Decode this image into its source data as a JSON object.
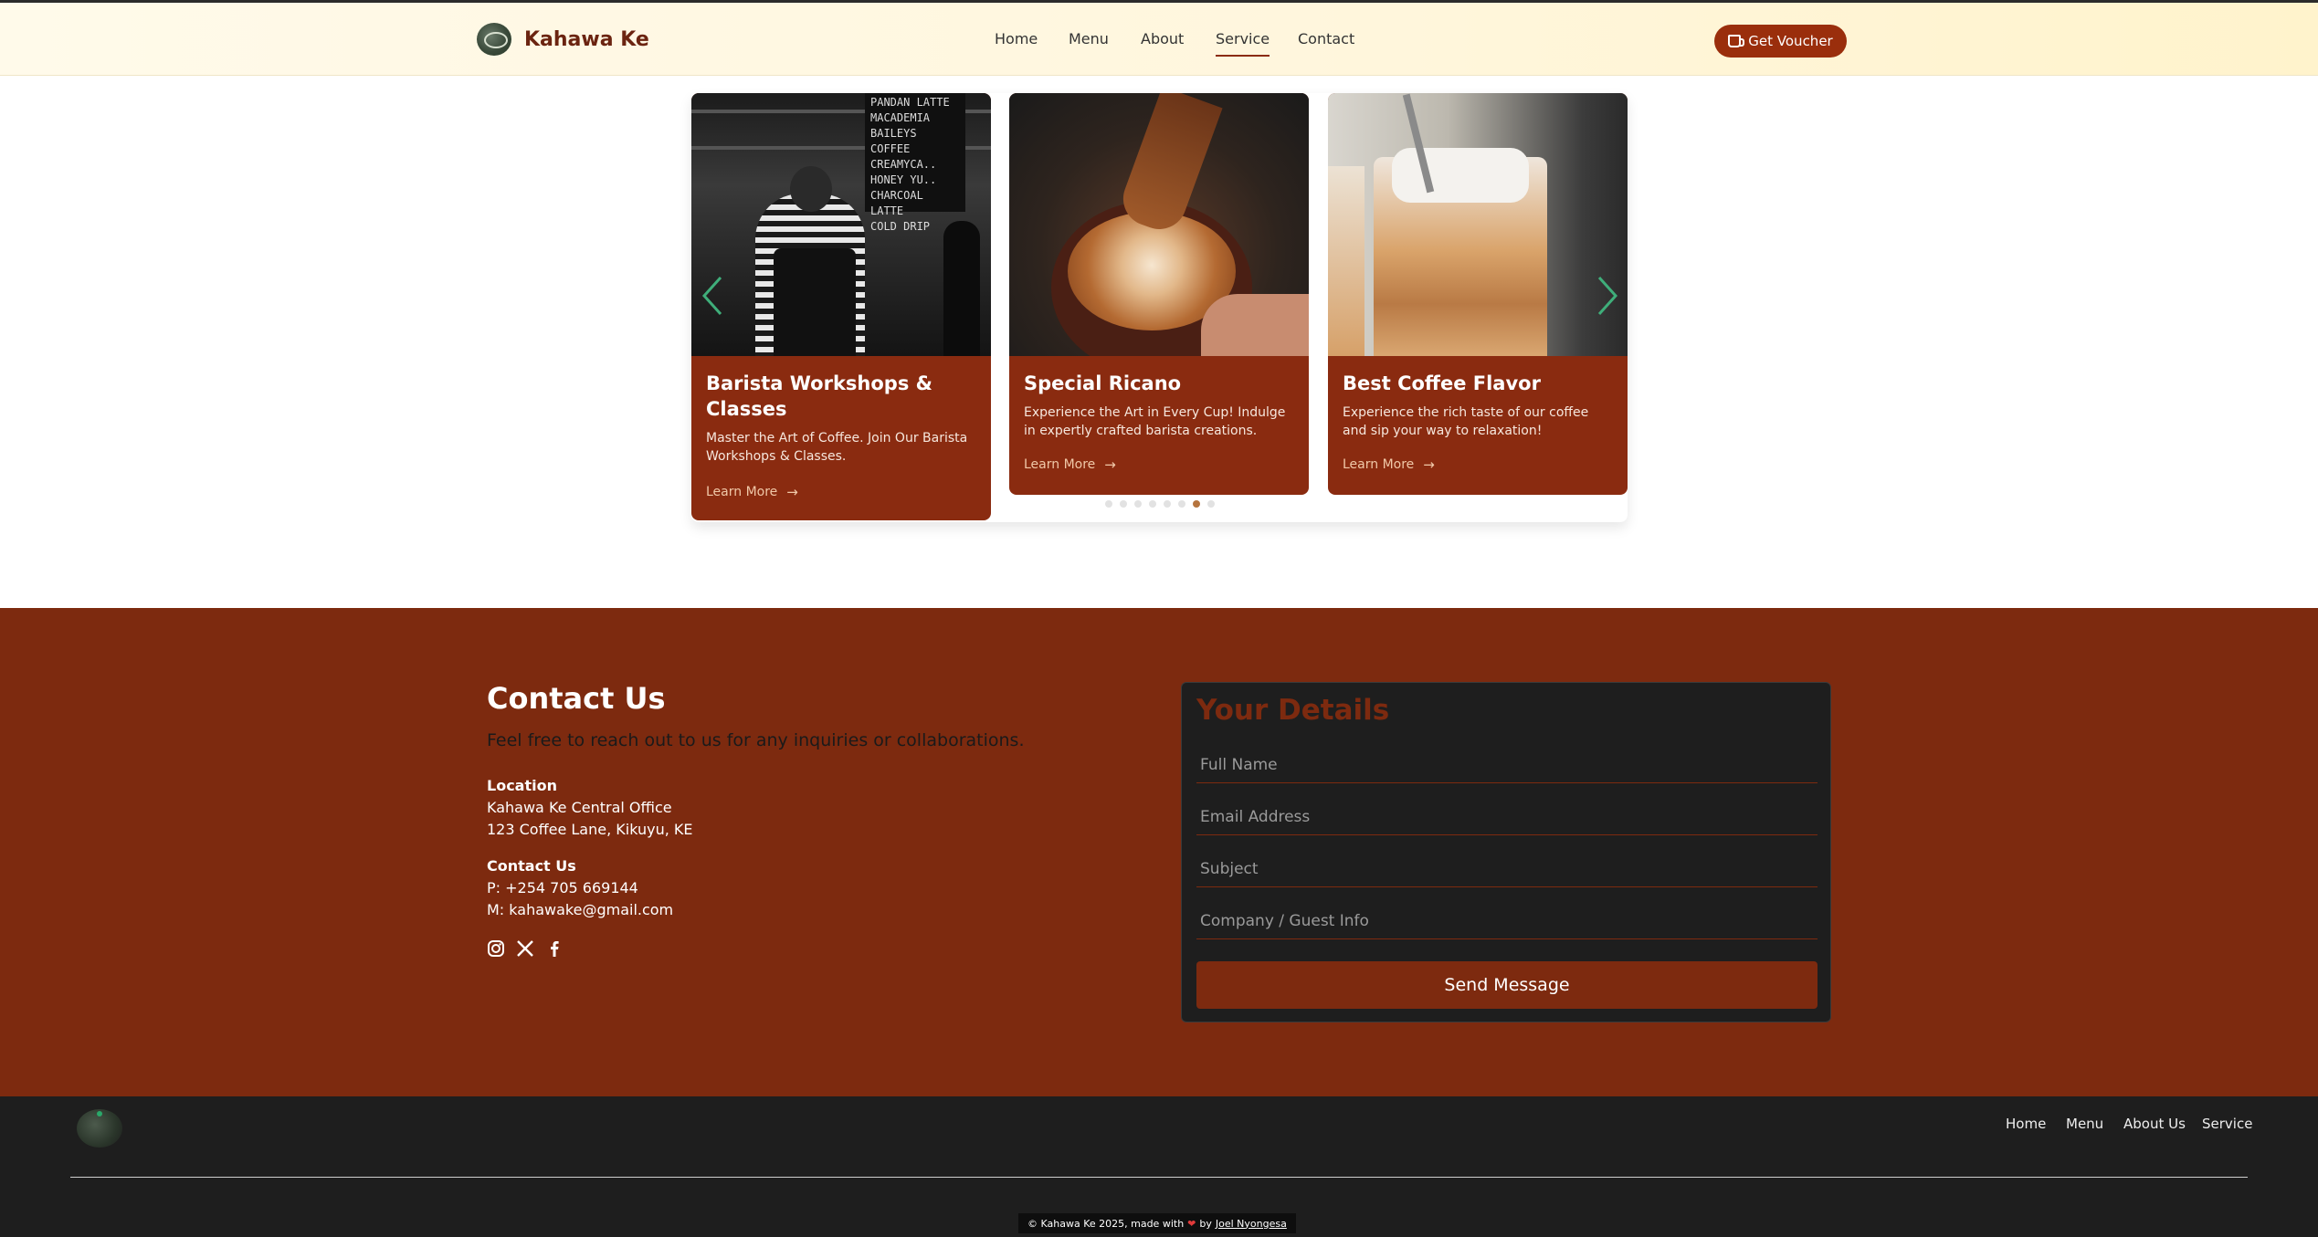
{
  "header": {
    "brand": "Kahawa Ke",
    "nav": [
      "Home",
      "Menu",
      "About",
      "Service",
      "Contact"
    ],
    "active_nav": "Service",
    "voucher_label": "Get Voucher",
    "voucher_icon": "coffee-cup-icon"
  },
  "carousel": {
    "cards": [
      {
        "title": "Barista Workshops & Classes",
        "description": "Master the Art of Coffee. Join Our Barista Workshops & Classes.",
        "link": "Learn More",
        "menu_board": [
          "PANDAN LATTE",
          "MACADEMIA",
          "BAILEYS COFFEE",
          "CREAMYCA..",
          "HONEY YU..",
          "CHARCOAL LATTE",
          "COLD DRIP"
        ]
      },
      {
        "title": "Special Ricano",
        "description": "Experience the Art in Every Cup! Indulge in expertly crafted barista creations.",
        "link": "Learn More"
      },
      {
        "title": "Best Coffee Flavor",
        "description": "Experience the rich taste of our coffee and sip your way to relaxation!",
        "link": "Learn More"
      }
    ],
    "dots_total": 8,
    "active_dot": 7,
    "accent": "#8a2b10"
  },
  "contact": {
    "title": "Contact Us",
    "subtitle": "Feel free to reach out to us for any inquiries or collaborations.",
    "location_label": "Location",
    "location_line1": "Kahawa Ke Central Office",
    "location_line2": "123 Coffee Lane, Kikuyu, KE",
    "contact_label": "Contact Us",
    "phone": "P: +254 705 669144",
    "email": "M: kahawake@gmail.com",
    "socials": [
      "instagram-icon",
      "x-icon",
      "facebook-icon"
    ],
    "form": {
      "title": "Your Details",
      "full_name_placeholder": "Full Name",
      "email_placeholder": "Email Address",
      "subject_placeholder": "Subject",
      "company_placeholder": "Company / Guest Info",
      "send_label": "Send Message"
    },
    "bg_color": "#7d2a0f"
  },
  "footer": {
    "nav": [
      "Home",
      "Menu",
      "About Us",
      "Service"
    ],
    "copyright_prefix": "© Kahawa Ke 2025, made with",
    "copyright_by": "by",
    "author": "Joel Nyongesa"
  }
}
